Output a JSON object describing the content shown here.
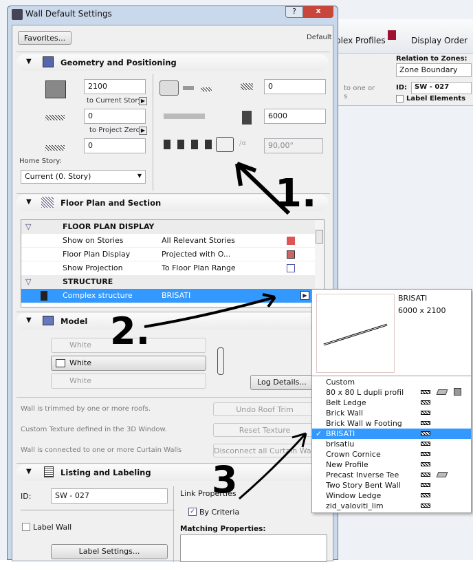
{
  "background_app": {
    "toolbar_items": [
      "plex Profiles",
      "Display Order"
    ],
    "relation_label": "Relation to Zones:",
    "relation_value": "Zone Boundary",
    "partial_text": "to one or",
    "partial_text2": "s",
    "id_label": "ID:",
    "id_value": "SW - 027",
    "label_elements": "Label Elements"
  },
  "dialog": {
    "title": "Wall Default Settings",
    "help": "?",
    "close": "x",
    "favorites": "Favorites...",
    "default_label": "Default"
  },
  "geometry": {
    "title": "Geometry and Positioning",
    "height": "2100",
    "to_current_story": "to Current Story",
    "bottom_offset": "0",
    "to_project_zero": "to Project Zero",
    "base_value": "0",
    "home_story_label": "Home Story:",
    "home_story_value": "Current (0. Story)",
    "ref_offset": "0",
    "length": "6000",
    "angle": "90,00°"
  },
  "floor_plan": {
    "title": "Floor Plan and Section",
    "groups": [
      {
        "label": "FLOOR PLAN DISPLAY",
        "rows": [
          {
            "name": "Show on Stories",
            "value": "All Relevant Stories"
          },
          {
            "name": "Floor Plan Display",
            "value": "Projected with O..."
          },
          {
            "name": "Show Projection",
            "value": "To Floor Plan Range"
          }
        ]
      },
      {
        "label": "STRUCTURE",
        "rows": [
          {
            "name": "Complex structure",
            "value": "BRISATI",
            "selected": true
          }
        ]
      }
    ]
  },
  "model": {
    "title": "Model",
    "surfaces": [
      "White",
      "White",
      "White"
    ],
    "log_details": "Log Details..."
  },
  "notices": [
    {
      "text": "Wall is trimmed by one or more roofs.",
      "button": "Undo Roof Trim"
    },
    {
      "text": "Custom Texture defined in the 3D Window.",
      "button": "Reset Texture"
    },
    {
      "text": "Wall is connected to one or more Curtain Walls",
      "button": "Disconnect all Curtain Walls"
    }
  ],
  "listing": {
    "title": "Listing and Labeling",
    "id_label": "ID:",
    "id_value": "SW - 027",
    "label_wall": "Label Wall",
    "label_settings": "Label Settings...",
    "link_properties": "Link Properties",
    "by_criteria": "By Criteria",
    "matching_properties": "Matching Properties:"
  },
  "profile_popup": {
    "preview_name": "BRISATI",
    "preview_size": "6000 x 2100",
    "items": [
      "Custom",
      "80 x 80 L dupli profil",
      "Belt Ledge",
      "Brick Wall",
      "Brick Wall w Footing",
      "BRISATI",
      "brisatiu",
      "Crown Cornice",
      "New Profile",
      "Precast Inverse Tee",
      "Two Story Bent Wall",
      "Window Ledge",
      "zid_valoviti_lim"
    ],
    "selected": "BRISATI",
    "selection_color": "#3399ff"
  },
  "annotations": [
    "1.",
    "2.",
    "3"
  ]
}
